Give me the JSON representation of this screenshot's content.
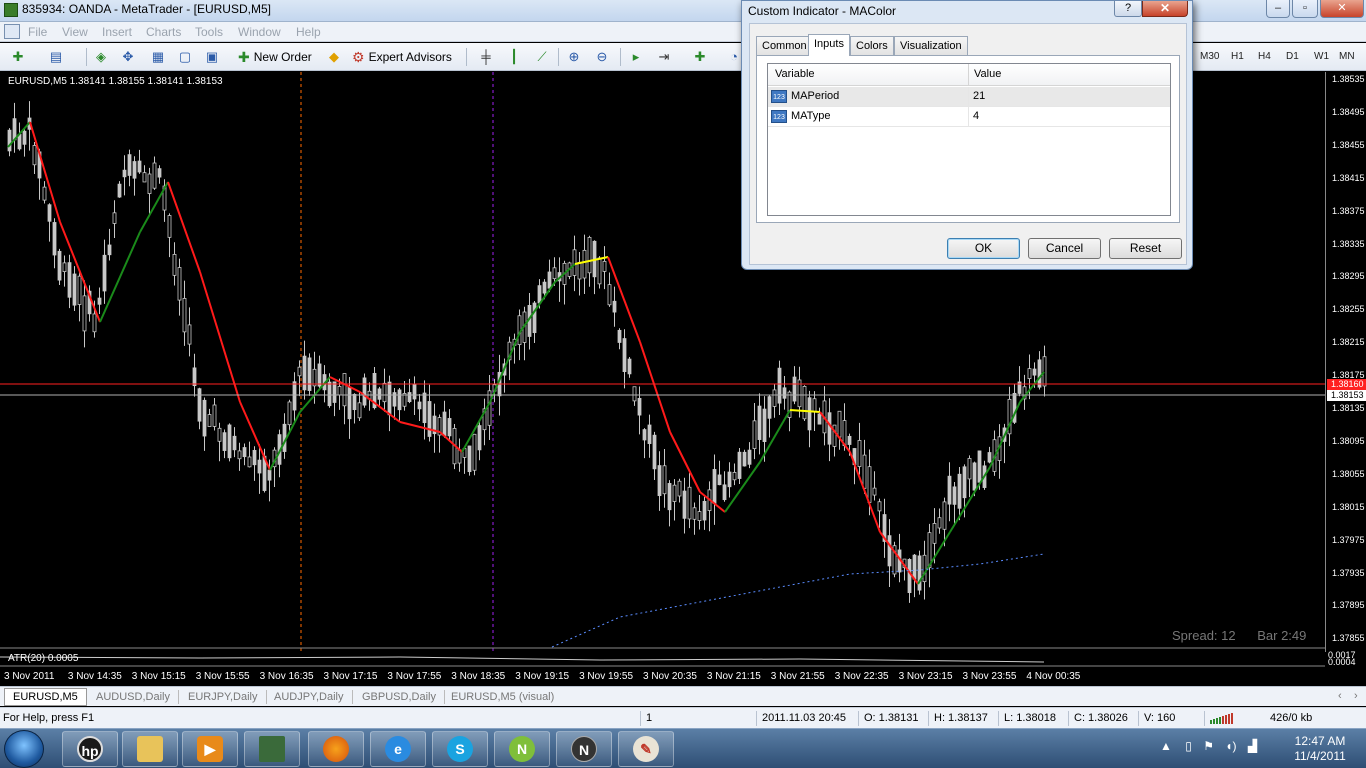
{
  "window": {
    "title": "835934: OANDA - MetaTrader - [EURUSD,M5]"
  },
  "menu": [
    "File",
    "View",
    "Insert",
    "Charts",
    "Tools",
    "Window",
    "Help"
  ],
  "toolbar": {
    "new_order": "New Order",
    "expert_advisors": "Expert Advisors",
    "timeframes": [
      "M30",
      "H1",
      "H4",
      "D1",
      "W1",
      "MN"
    ]
  },
  "chart": {
    "header": "EURUSD,M5  1.38141 1.38155 1.38141 1.38153",
    "price_labels": [
      "1.38535",
      "1.38495",
      "1.38455",
      "1.38415",
      "1.38375",
      "1.38335",
      "1.38295",
      "1.38255",
      "1.38215",
      "1.38175",
      "1.38135",
      "1.38095",
      "1.38055",
      "1.38015",
      "1.37975",
      "1.37935",
      "1.37895",
      "1.37855"
    ],
    "bid_tag": "1.38160",
    "ask_tag": "1.38153",
    "time_labels": [
      "3 Nov 2011",
      "3 Nov 14:35",
      "3 Nov 15:15",
      "3 Nov 15:55",
      "3 Nov 16:35",
      "3 Nov 17:15",
      "3 Nov 17:55",
      "3 Nov 18:35",
      "3 Nov 19:15",
      "3 Nov 19:55",
      "3 Nov 20:35",
      "3 Nov 21:15",
      "3 Nov 21:55",
      "3 Nov 22:35",
      "3 Nov 23:15",
      "3 Nov 23:55",
      "4 Nov 00:35"
    ],
    "spread": "Spread: 12",
    "bar_timer": "Bar  2:49",
    "atr_label": "ATR(20) 0.0005",
    "atr_value": "0.0017",
    "atr_zero": "0.0004",
    "colors": {
      "up_ma": "#1a8a1a",
      "down_ma": "#ff1a1a",
      "flat_ma": "#ffff00",
      "candles": "#c8c8c8",
      "bid_line": "#ff2020",
      "ask_line": "#b0b0b0",
      "period_sep_1": "#ff6a00",
      "period_sep_2": "#a020f0",
      "long_ma": "#5a8cff"
    }
  },
  "chart_tabs": [
    "EURUSD,M5",
    "AUDUSD,Daily",
    "EURJPY,Daily",
    "AUDJPY,Daily",
    "GBPUSD,Daily",
    "EURUSD,M5 (visual)"
  ],
  "status": {
    "help": "For Help, press F1",
    "one": "1",
    "time": "2011.11.03 20:45",
    "open": "O: 1.38131",
    "high": "H: 1.38137",
    "low": "L: 1.38018",
    "close": "C: 1.38026",
    "volume": "V: 160",
    "traffic": "426/0 kb"
  },
  "dialog": {
    "title": "Custom Indicator - MAColor",
    "help_btn": "?",
    "close_btn": "✕",
    "tabs": [
      "Common",
      "Inputs",
      "Colors",
      "Visualization"
    ],
    "grid_headers": [
      "Variable",
      "Value"
    ],
    "rows": [
      {
        "variable": "MAPeriod",
        "value": "21",
        "icon": "123"
      },
      {
        "variable": "MAType",
        "value": "4",
        "icon": "123"
      }
    ],
    "buttons": {
      "ok": "OK",
      "cancel": "Cancel",
      "reset": "Reset"
    }
  },
  "taskbar": {
    "clock_time": "12:47 AM",
    "clock_date": "11/4/2011"
  }
}
